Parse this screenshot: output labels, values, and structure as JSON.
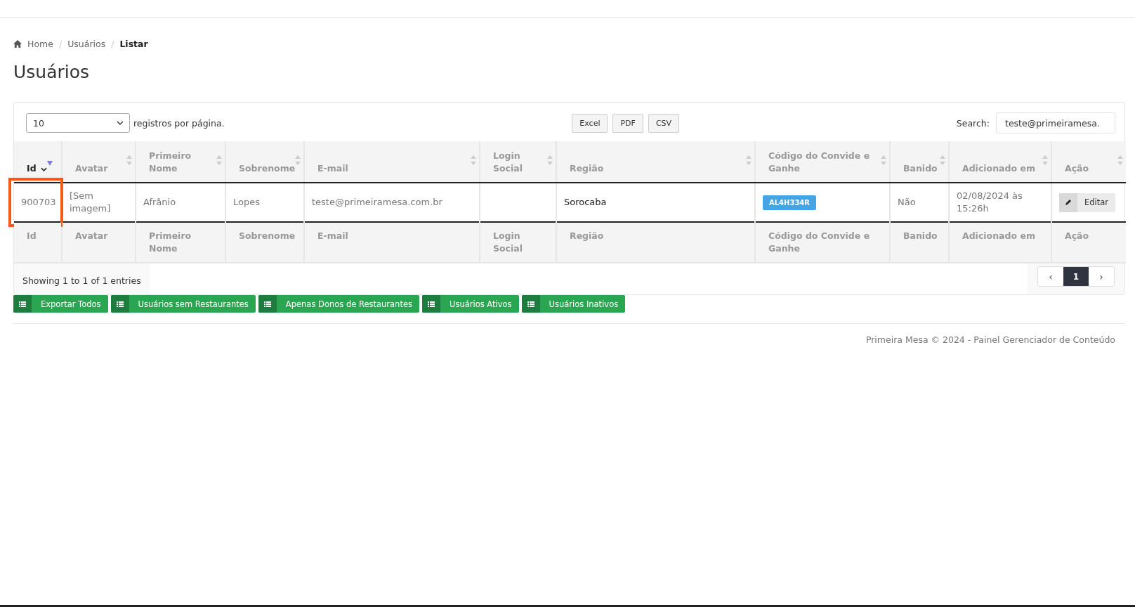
{
  "breadcrumb": [
    {
      "label": "Home",
      "current": false
    },
    {
      "label": "Usuários",
      "current": false
    },
    {
      "label": "Listar",
      "current": true
    }
  ],
  "breadcrumb_separator": "/",
  "page_title": "Usuários",
  "length_select": {
    "value": "10",
    "label": "registros por página."
  },
  "export_buttons": [
    "Excel",
    "PDF",
    "CSV"
  ],
  "search": {
    "label": "Search:",
    "value": "teste@primeiramesa."
  },
  "table": {
    "columns": [
      {
        "label": "Id",
        "sorted": true
      },
      {
        "label": "Avatar",
        "sorted": false
      },
      {
        "label": "Primeiro Nome",
        "sorted": false
      },
      {
        "label": "Sobrenome",
        "sorted": false
      },
      {
        "label": "E-mail",
        "sorted": false
      },
      {
        "label": "Login Social",
        "sorted": false
      },
      {
        "label": "Região",
        "sorted": false
      },
      {
        "label": "Código do Convide e Ganhe",
        "sorted": false
      },
      {
        "label": "Banido",
        "sorted": false
      },
      {
        "label": "Adicionado em",
        "sorted": false
      },
      {
        "label": "Ação",
        "sorted": false
      }
    ],
    "rows": [
      {
        "id": "900703",
        "highlighted": true,
        "avatar": "[Sem imagem]",
        "first_name": "Afrânio",
        "last_name": "Lopes",
        "email": "teste@primeiramesa.com.br",
        "login_social": "",
        "region": "Sorocaba",
        "invite_code": "AL4H334R",
        "banned": "Não",
        "added": "02/08/2024 às 15:26h",
        "action": "Editar"
      }
    ],
    "footer_columns": [
      "Id",
      "Avatar",
      "Primeiro Nome",
      "Sobrenome",
      "E-mail",
      "Login Social",
      "Região",
      "Código do Convide e Ganhe",
      "Banido",
      "Adicionado em",
      "Ação"
    ]
  },
  "info": "Showing 1 to 1 of 1 entries",
  "pagination": {
    "prev": "‹",
    "pages": [
      {
        "label": "1",
        "selected": true
      }
    ],
    "next": "›"
  },
  "filter_buttons": [
    "Exportar Todos",
    "Usuários sem Restaurantes",
    "Apenas Donos de Restaurantes",
    "Usuários Ativos",
    "Usuários Inativos"
  ],
  "footer": "Primeira Mesa © 2024 - Painel Gerenciador de Conteúdo"
}
